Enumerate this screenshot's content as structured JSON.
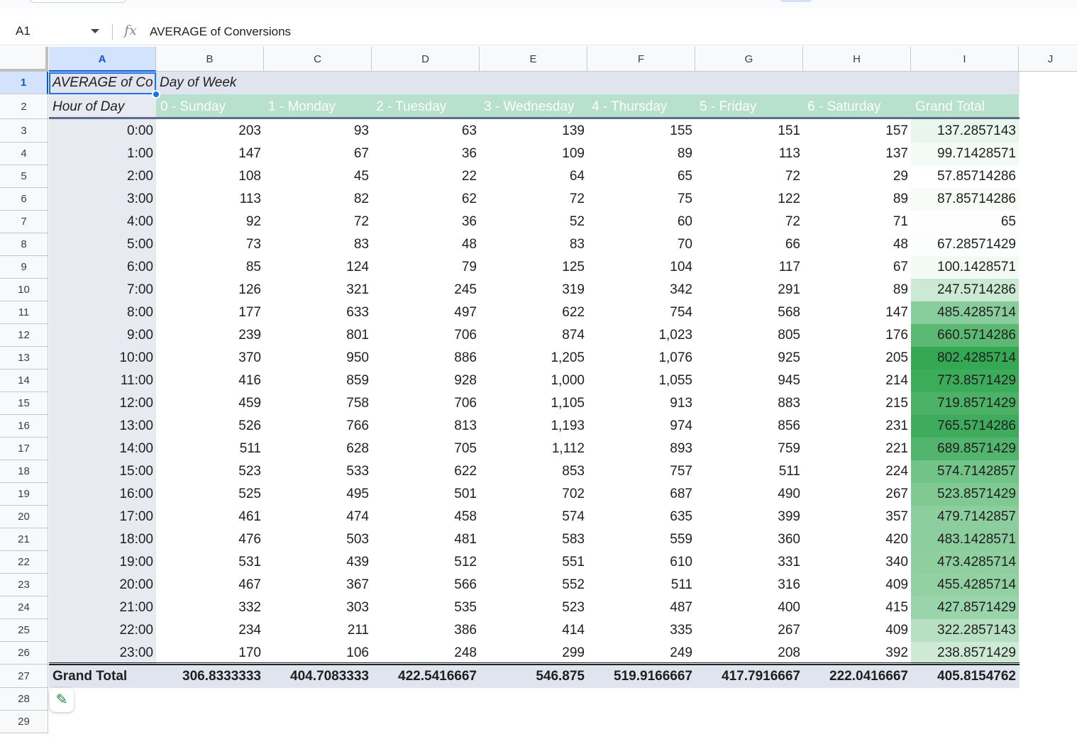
{
  "formula_bar": {
    "name_box": "A1",
    "fx_label": "fx",
    "formula": "AVERAGE of Conversions"
  },
  "columns": [
    "A",
    "B",
    "C",
    "D",
    "E",
    "F",
    "G",
    "H",
    "I",
    "J"
  ],
  "pivot": {
    "title": "AVERAGE of Conversions",
    "title_visible": "AVERAGE of Co",
    "column_group_label": "Day of Week",
    "row_group_label": "Hour of Day",
    "day_headers": [
      "0 - Sunday",
      "1 - Monday",
      "2 - Tuesday",
      "3 - Wednesday",
      "4 - Thursday",
      "5 - Friday",
      "6 - Saturday",
      "Grand Total"
    ],
    "rows": [
      {
        "hour": "0:00",
        "values": [
          "203",
          "93",
          "63",
          "139",
          "155",
          "151",
          "157"
        ],
        "total": "137.2857143"
      },
      {
        "hour": "1:00",
        "values": [
          "147",
          "67",
          "36",
          "109",
          "89",
          "113",
          "137"
        ],
        "total": "99.71428571"
      },
      {
        "hour": "2:00",
        "values": [
          "108",
          "45",
          "22",
          "64",
          "65",
          "72",
          "29"
        ],
        "total": "57.85714286"
      },
      {
        "hour": "3:00",
        "values": [
          "113",
          "82",
          "62",
          "72",
          "75",
          "122",
          "89"
        ],
        "total": "87.85714286"
      },
      {
        "hour": "4:00",
        "values": [
          "92",
          "72",
          "36",
          "52",
          "60",
          "72",
          "71"
        ],
        "total": "65"
      },
      {
        "hour": "5:00",
        "values": [
          "73",
          "83",
          "48",
          "83",
          "70",
          "66",
          "48"
        ],
        "total": "67.28571429"
      },
      {
        "hour": "6:00",
        "values": [
          "85",
          "124",
          "79",
          "125",
          "104",
          "117",
          "67"
        ],
        "total": "100.1428571"
      },
      {
        "hour": "7:00",
        "values": [
          "126",
          "321",
          "245",
          "319",
          "342",
          "291",
          "89"
        ],
        "total": "247.5714286"
      },
      {
        "hour": "8:00",
        "values": [
          "177",
          "633",
          "497",
          "622",
          "754",
          "568",
          "147"
        ],
        "total": "485.4285714"
      },
      {
        "hour": "9:00",
        "values": [
          "239",
          "801",
          "706",
          "874",
          "1,023",
          "805",
          "176"
        ],
        "total": "660.5714286"
      },
      {
        "hour": "10:00",
        "values": [
          "370",
          "950",
          "886",
          "1,205",
          "1,076",
          "925",
          "205"
        ],
        "total": "802.4285714"
      },
      {
        "hour": "11:00",
        "values": [
          "416",
          "859",
          "928",
          "1,000",
          "1,055",
          "945",
          "214"
        ],
        "total": "773.8571429"
      },
      {
        "hour": "12:00",
        "values": [
          "459",
          "758",
          "706",
          "1,105",
          "913",
          "883",
          "215"
        ],
        "total": "719.8571429"
      },
      {
        "hour": "13:00",
        "values": [
          "526",
          "766",
          "813",
          "1,193",
          "974",
          "856",
          "231"
        ],
        "total": "765.5714286"
      },
      {
        "hour": "14:00",
        "values": [
          "511",
          "628",
          "705",
          "1,112",
          "893",
          "759",
          "221"
        ],
        "total": "689.8571429"
      },
      {
        "hour": "15:00",
        "values": [
          "523",
          "533",
          "622",
          "853",
          "757",
          "511",
          "224"
        ],
        "total": "574.7142857"
      },
      {
        "hour": "16:00",
        "values": [
          "525",
          "495",
          "501",
          "702",
          "687",
          "490",
          "267"
        ],
        "total": "523.8571429"
      },
      {
        "hour": "17:00",
        "values": [
          "461",
          "474",
          "458",
          "574",
          "635",
          "399",
          "357"
        ],
        "total": "479.7142857"
      },
      {
        "hour": "18:00",
        "values": [
          "476",
          "503",
          "481",
          "583",
          "559",
          "360",
          "420"
        ],
        "total": "483.1428571"
      },
      {
        "hour": "19:00",
        "values": [
          "531",
          "439",
          "512",
          "551",
          "610",
          "331",
          "340"
        ],
        "total": "473.4285714"
      },
      {
        "hour": "20:00",
        "values": [
          "467",
          "367",
          "566",
          "552",
          "511",
          "316",
          "409"
        ],
        "total": "455.4285714"
      },
      {
        "hour": "21:00",
        "values": [
          "332",
          "303",
          "535",
          "523",
          "487",
          "400",
          "415"
        ],
        "total": "427.8571429"
      },
      {
        "hour": "22:00",
        "values": [
          "234",
          "211",
          "386",
          "414",
          "335",
          "267",
          "409"
        ],
        "total": "322.2857143"
      },
      {
        "hour": "23:00",
        "values": [
          "170",
          "106",
          "248",
          "299",
          "249",
          "208",
          "392"
        ],
        "total": "238.8571429"
      }
    ],
    "grand_total": {
      "label": "Grand Total",
      "values": [
        "306.8333333",
        "404.7083333",
        "422.5416667",
        "546.875",
        "519.9166667",
        "417.7916667",
        "222.0416667"
      ],
      "total": "405.8154762"
    }
  },
  "row_numbers": [
    "1",
    "2",
    "3",
    "4",
    "5",
    "6",
    "7",
    "8",
    "9",
    "10",
    "11",
    "12",
    "13",
    "14",
    "15",
    "16",
    "17",
    "18",
    "19",
    "20",
    "21",
    "22",
    "23",
    "24",
    "25",
    "26",
    "27",
    "28",
    "29"
  ],
  "colors": {
    "selection": "#1a73e8",
    "header_band": "#e0e4ef",
    "day_header_bg": "#b7e1cd",
    "scale_min": "#ffffff",
    "scale_max": "#34a853"
  },
  "icons": {
    "edit": "pencil-icon",
    "namebox_dropdown": "chevron-down-icon",
    "formula": "fx-icon"
  }
}
